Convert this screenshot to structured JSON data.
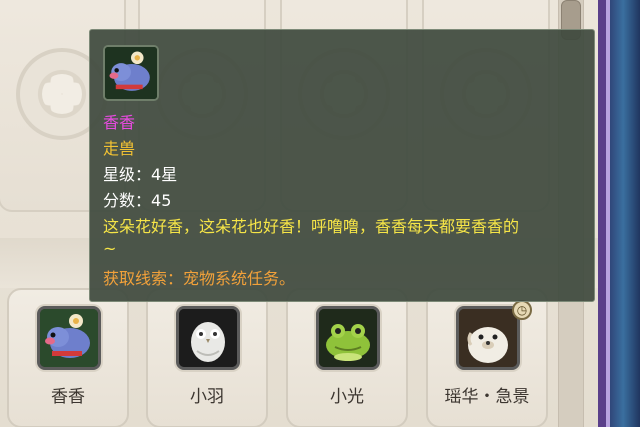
{
  "tooltip": {
    "pet_name": "香香",
    "pet_type": "走兽",
    "star_label": "星级：",
    "star_value": "4星",
    "score_label": "分数：",
    "score_value": "45",
    "description": "这朵花好香，这朵花也好香！呼噜噜，香香每天都要香香的",
    "description_cont": "~",
    "hint_label": "获取线索：",
    "hint_value": "宠物系统任务。",
    "colors": {
      "name": "#e84be0",
      "type": "#f2c233",
      "description": "#f6e547",
      "hint": "#f2a13a"
    }
  },
  "pets": [
    {
      "name": "香香",
      "icon": "pig-pet-icon"
    },
    {
      "name": "小羽",
      "icon": "owl-pet-icon"
    },
    {
      "name": "小光",
      "icon": "frog-pet-icon"
    },
    {
      "name": "瑶华・急景",
      "icon": "seal-pet-icon",
      "badge": "clock-icon"
    }
  ]
}
